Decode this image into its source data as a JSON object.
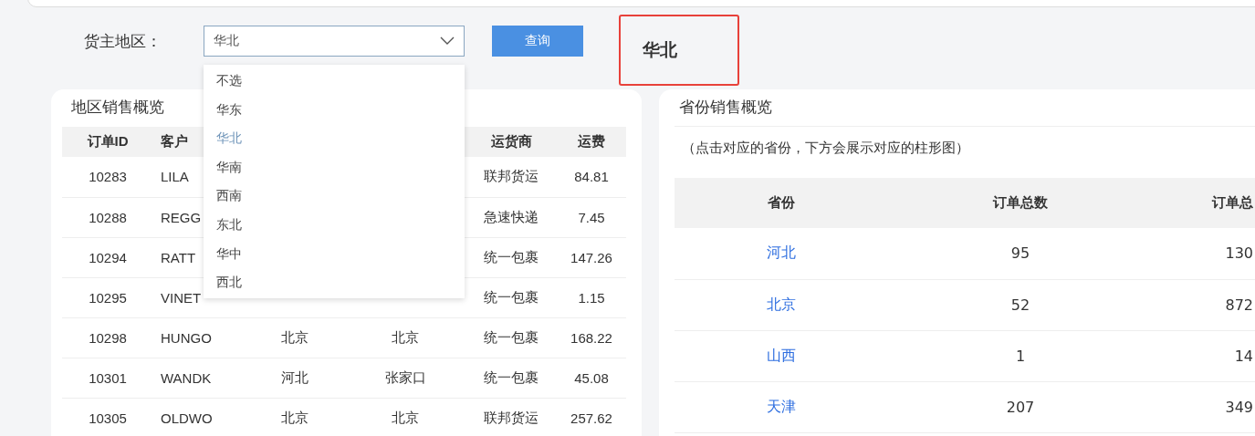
{
  "filter": {
    "label": "货主地区：",
    "value": "华北",
    "button": "查询",
    "result": "华北"
  },
  "dropdown": {
    "options": [
      {
        "label": "不选",
        "selected": false
      },
      {
        "label": "华东",
        "selected": false
      },
      {
        "label": "华北",
        "selected": true
      },
      {
        "label": "华南",
        "selected": false
      },
      {
        "label": "西南",
        "selected": false
      },
      {
        "label": "东北",
        "selected": false
      },
      {
        "label": "华中",
        "selected": false
      },
      {
        "label": "西北",
        "selected": false
      }
    ]
  },
  "region_panel": {
    "title": "地区销售概览",
    "columns": [
      "订单ID",
      "客户",
      "",
      "",
      "运货商",
      "运费"
    ],
    "rows": [
      [
        "10283",
        "LILA",
        "",
        "",
        "联邦货运",
        "84.81"
      ],
      [
        "10288",
        "REGG",
        "",
        "",
        "急速快递",
        "7.45"
      ],
      [
        "10294",
        "RATT",
        "",
        "",
        "统一包裹",
        "147.26"
      ],
      [
        "10295",
        "VINET",
        "",
        "",
        "统一包裹",
        "1.15"
      ],
      [
        "10298",
        "HUNGO",
        "北京",
        "北京",
        "统一包裹",
        "168.22"
      ],
      [
        "10301",
        "WANDK",
        "河北",
        "张家口",
        "统一包裹",
        "45.08"
      ],
      [
        "10305",
        "OLDWO",
        "北京",
        "北京",
        "联邦货运",
        "257.62"
      ]
    ]
  },
  "province_panel": {
    "title": "省份销售概览",
    "note": "（点击对应的省份，下方会展示对应的柱形图）",
    "columns": [
      "省份",
      "订单总数",
      "订单总"
    ],
    "rows": [
      [
        "河北",
        "95",
        "130"
      ],
      [
        "北京",
        "52",
        "872"
      ],
      [
        "山西",
        "1",
        "14"
      ],
      [
        "天津",
        "207",
        "349"
      ]
    ]
  }
}
